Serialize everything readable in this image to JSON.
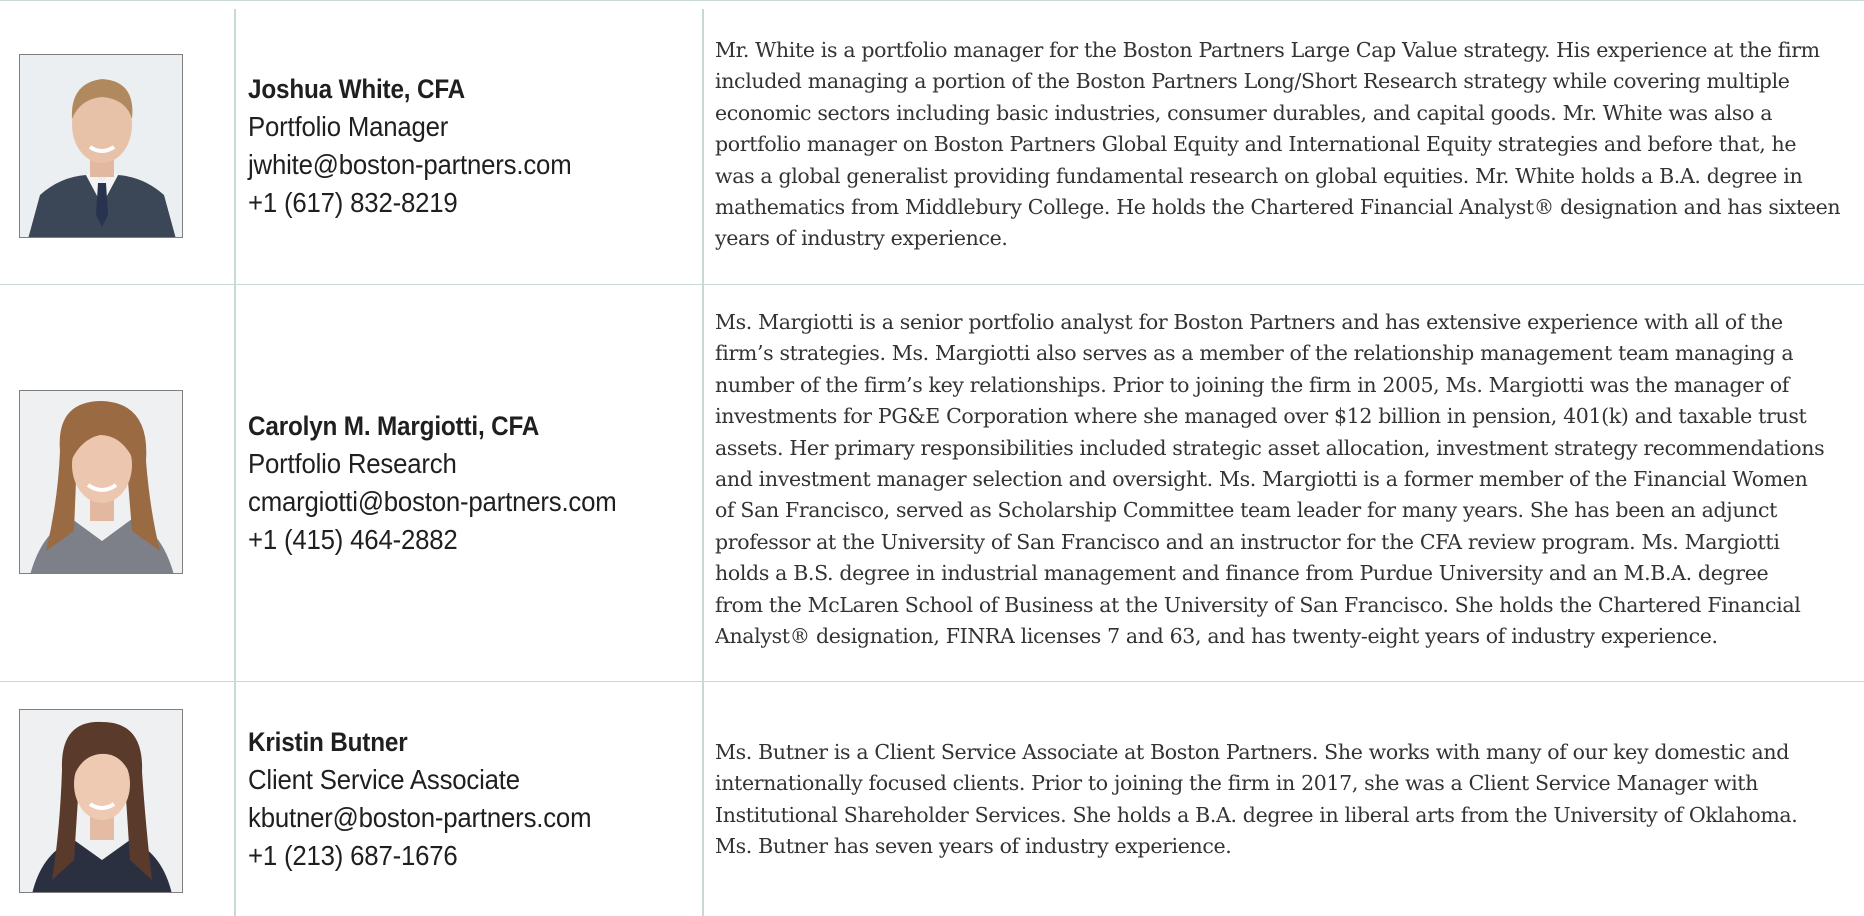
{
  "people": [
    {
      "name": "Joshua White, CFA",
      "title": "Portfolio Manager",
      "email": "jwhite@boston-partners.com",
      "phone": "+1 (617) 832-8219",
      "bio_lines": [
        "Mr. White is a portfolio manager for the Boston Partners Large Cap Value strategy. His experience at the firm",
        "included managing a portion of the Boston Partners Long/Short Research strategy while covering multiple",
        "economic sectors including basic industries, consumer durables, and capital goods. Mr. White was also a",
        "portfolio manager on Boston Partners Global Equity and International Equity strategies and before that, he",
        "was a global generalist providing fundamental research on global equities. Mr. White holds a B.A. degree in",
        "mathematics from Middlebury College. He holds the Chartered Financial Analyst® designation and has sixteen",
        "years of industry experience."
      ]
    },
    {
      "name": "Carolyn M. Margiotti, CFA",
      "title": "Portfolio Research",
      "email": "cmargiotti@boston-partners.com",
      "phone": "+1 (415) 464-2882",
      "bio_lines": [
        "Ms. Margiotti is a senior portfolio analyst for Boston Partners and has extensive experience with all of the",
        "firm’s strategies. Ms. Margiotti also serves as a member of the relationship management team managing a",
        "number of the firm’s key relationships. Prior to joining the firm in 2005, Ms. Margiotti was the manager of",
        "investments for PG&E Corporation where she managed over $12 billion in pension, 401(k) and taxable trust",
        "assets. Her primary responsibilities included strategic asset allocation, investment strategy recommendations",
        "and investment manager selection and oversight. Ms. Margiotti is a former member of the Financial Women",
        "of San Francisco, served as Scholarship Committee team leader for many years. She has been an adjunct",
        "professor at the University of San Francisco and an instructor for the CFA review program. Ms. Margiotti",
        "holds a B.S. degree in industrial management and finance from Purdue University and an M.B.A. degree",
        "from the McLaren School of Business at the University of San Francisco. She holds the Chartered Financial",
        "Analyst® designation, FINRA licenses 7 and 63, and has twenty-eight years of industry experience."
      ]
    },
    {
      "name": "Kristin Butner",
      "title": "Client Service Associate",
      "email": "kbutner@boston-partners.com",
      "phone": "+1 (213) 687-1676",
      "bio_lines": [
        "Ms. Butner is a Client Service Associate at Boston Partners. She works with many of our key domestic and",
        "internationally focused clients. Prior to joining the firm in 2017, she was a Client Service Manager with",
        "Institutional Shareholder Services. She holds a B.A. degree in liberal arts from the University of Oklahoma.",
        "Ms. Butner has seven years of industry experience."
      ]
    }
  ],
  "colors": {
    "rule": "#c7d9d6",
    "text": "#1f1f1f",
    "bio_text": "#333333"
  }
}
